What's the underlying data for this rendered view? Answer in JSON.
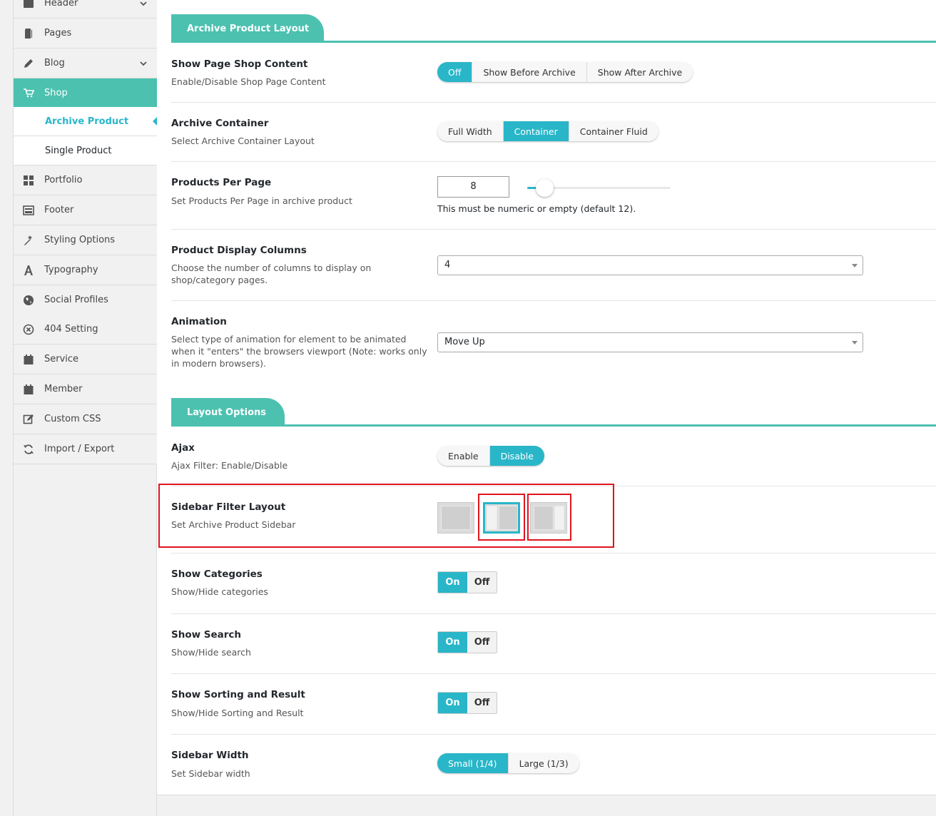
{
  "sidebar": {
    "items": [
      {
        "label": "Header",
        "icon": "header-icon"
      },
      {
        "label": "Pages",
        "icon": "pages-icon"
      },
      {
        "label": "Blog",
        "icon": "pencil-icon"
      },
      {
        "label": "Shop",
        "icon": "cart-icon"
      },
      {
        "label": "Portfolio",
        "icon": "grid-icon"
      },
      {
        "label": "Footer",
        "icon": "footer-icon"
      },
      {
        "label": "Styling Options",
        "icon": "magic-wand-icon"
      },
      {
        "label": "Typography",
        "icon": "font-icon"
      },
      {
        "label": "Social Profiles",
        "icon": "globe-icon"
      },
      {
        "label": "404 Setting",
        "icon": "circle-x-icon"
      },
      {
        "label": "Service",
        "icon": "calendar-icon"
      },
      {
        "label": "Member",
        "icon": "calendar-icon"
      },
      {
        "label": "Custom CSS",
        "icon": "edit-icon"
      },
      {
        "label": "Import / Export",
        "icon": "refresh-icon"
      }
    ],
    "shop_sub": [
      {
        "label": "Archive Product"
      },
      {
        "label": "Single Product"
      }
    ]
  },
  "sections": {
    "archive": "Archive Product Layout",
    "layout": "Layout Options"
  },
  "rows": {
    "show_page_shop_content": {
      "title": "Show Page Shop Content",
      "desc": "Enable/Disable Shop Page Content",
      "options": [
        "Off",
        "Show Before Archive",
        "Show After Archive"
      ],
      "selected": "Off"
    },
    "archive_container": {
      "title": "Archive Container",
      "desc": "Select Archive Container Layout",
      "options": [
        "Full Width",
        "Container",
        "Container Fluid"
      ],
      "selected": "Container"
    },
    "products_per_page": {
      "title": "Products Per Page",
      "desc": "Set Products Per Page in archive product",
      "value": "8",
      "hint": "This must be numeric or empty (default 12).",
      "slider_fraction": 0.12
    },
    "product_display_columns": {
      "title": "Product Display Columns",
      "desc": "Choose the number of columns to display on shop/category pages.",
      "value": "4"
    },
    "animation": {
      "title": "Animation",
      "desc": "Select type of animation for element to be animated when it \"enters\" the browsers viewport (Note: works only in modern browsers).",
      "value": "Move Up"
    },
    "ajax": {
      "title": "Ajax",
      "desc": "Ajax Filter: Enable/Disable",
      "options": [
        "Enable",
        "Disable"
      ],
      "selected": "Disable"
    },
    "sidebar_filter_layout": {
      "title": "Sidebar Filter Layout",
      "desc": "Set Archive Product Sidebar",
      "options": [
        "no-sidebar",
        "left-sidebar",
        "right-sidebar"
      ],
      "selected": "left-sidebar"
    },
    "show_categories": {
      "title": "Show Categories",
      "desc": "Show/Hide categories",
      "on": "On",
      "off": "Off"
    },
    "show_search": {
      "title": "Show Search",
      "desc": "Show/Hide search",
      "on": "On",
      "off": "Off"
    },
    "show_sorting": {
      "title": "Show Sorting and Result",
      "desc": "Show/Hide Sorting and Result",
      "on": "On",
      "off": "Off"
    },
    "sidebar_width": {
      "title": "Sidebar Width",
      "desc": "Set Sidebar width",
      "options": [
        "Small (1/4)",
        "Large (1/3)"
      ],
      "selected": "Small (1/4)"
    }
  },
  "colors": {
    "accent": "#29b6c8",
    "section": "#4cc1b0",
    "highlight": "#e0141e"
  }
}
